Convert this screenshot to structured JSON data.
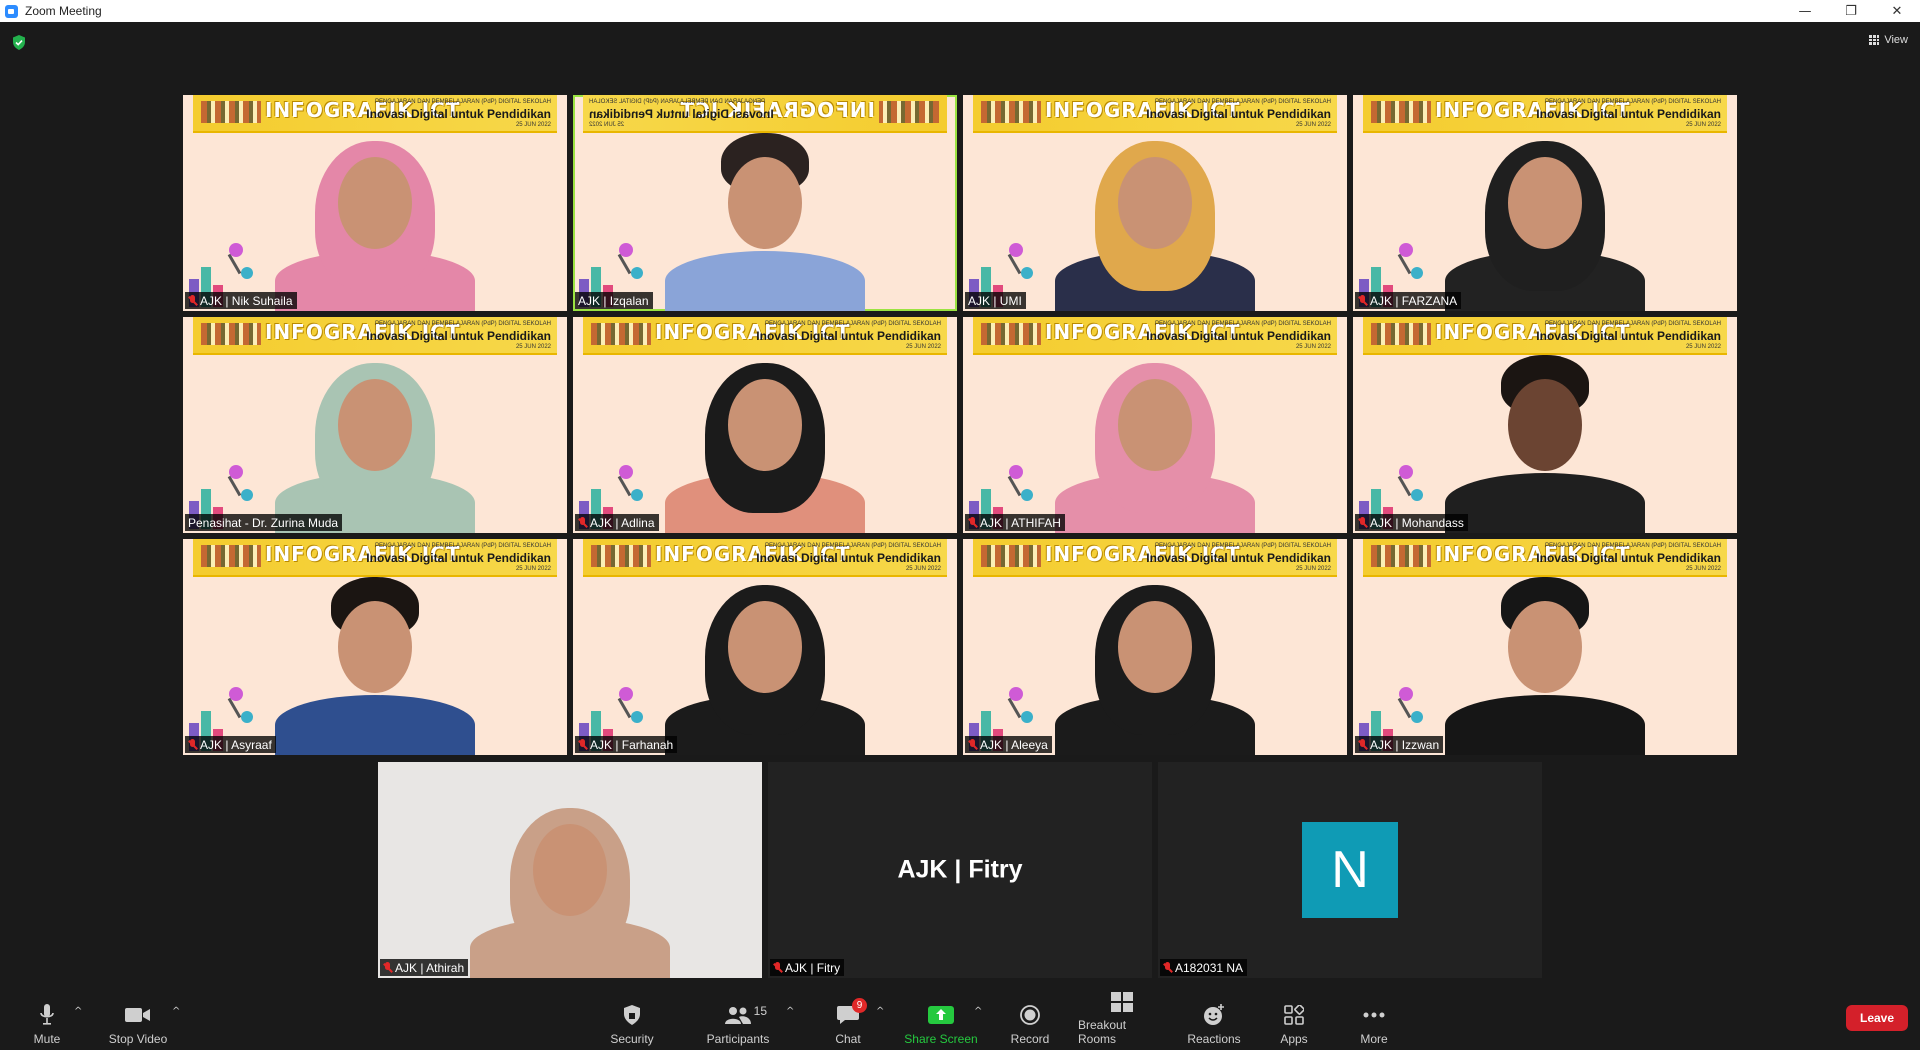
{
  "window": {
    "title": "Zoom Meeting",
    "minimize": "—",
    "restore": "❐",
    "close": "✕"
  },
  "topbar": {
    "view_label": "View"
  },
  "banner": {
    "big": "INFOGRAFIK ICT",
    "small": "PENGAJARAN DAN PEMBELAJARAN (PdP) DIGITAL SEKOLAH",
    "sub": "Inovasi Digital untuk Pendidikan",
    "date": "25 JUN 2022"
  },
  "participants": [
    {
      "name": "AJK | Nik Suhaila",
      "muted": true
    },
    {
      "name": "AJK | Izqalan",
      "muted": false
    },
    {
      "name": "AJK | UMI",
      "muted": false
    },
    {
      "name": "AJK | FARZANA",
      "muted": true
    },
    {
      "name": "Penasihat - Dr. Zurina Muda",
      "muted": false
    },
    {
      "name": "AJK | Adlina",
      "muted": true
    },
    {
      "name": "AJK | ATHIFAH",
      "muted": true
    },
    {
      "name": "AJK | Mohandass",
      "muted": true
    },
    {
      "name": "AJK | Asyraaf",
      "muted": true
    },
    {
      "name": "AJK | Farhanah",
      "muted": true
    },
    {
      "name": "AJK | Aleeya",
      "muted": true
    },
    {
      "name": "AJK | Izzwan",
      "muted": true
    },
    {
      "name": "AJK | Athirah",
      "muted": true
    },
    {
      "name": "AJK | Fitry",
      "muted": true,
      "display_name": "AJK | Fitry"
    },
    {
      "name": "A182031 NA",
      "muted": true,
      "avatar_letter": "N"
    }
  ],
  "toolbar": {
    "mute": "Mute",
    "stop_video": "Stop Video",
    "security": "Security",
    "participants": "Participants",
    "participants_count": "15",
    "chat": "Chat",
    "chat_badge": "9",
    "share_screen": "Share Screen",
    "record": "Record",
    "breakout_rooms": "Breakout Rooms",
    "reactions": "Reactions",
    "apps": "Apps",
    "more": "More",
    "leave": "Leave",
    "caret": "^"
  },
  "colors": {
    "accent_green": "#25c93f",
    "leave_red": "#d4202a",
    "avatar_teal": "#0f9bb5",
    "speaking_border": "#9be342"
  }
}
